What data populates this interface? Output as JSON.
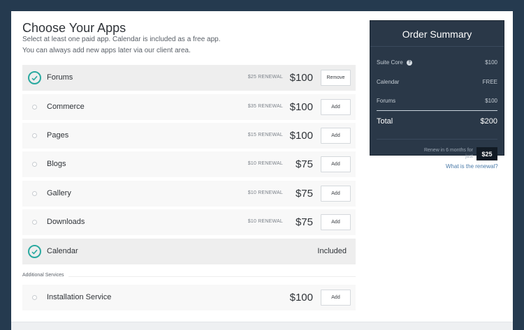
{
  "header": {
    "title": "Choose Your Apps",
    "subtitle_1": "Select at least one paid app. Calendar is included as a free app.",
    "subtitle_2": "You can always add new apps later via our client area."
  },
  "apps": [
    {
      "name": "Forums",
      "renewal": "$25 RENEWAL",
      "price": "$100",
      "button": "Remove",
      "selected": true
    },
    {
      "name": "Commerce",
      "renewal": "$35 RENEWAL",
      "price": "$100",
      "button": "Add",
      "selected": false
    },
    {
      "name": "Pages",
      "renewal": "$15 RENEWAL",
      "price": "$100",
      "button": "Add",
      "selected": false
    },
    {
      "name": "Blogs",
      "renewal": "$10 RENEWAL",
      "price": "$75",
      "button": "Add",
      "selected": false
    },
    {
      "name": "Gallery",
      "renewal": "$10 RENEWAL",
      "price": "$75",
      "button": "Add",
      "selected": false
    },
    {
      "name": "Downloads",
      "renewal": "$10 RENEWAL",
      "price": "$75",
      "button": "Add",
      "selected": false
    },
    {
      "name": "Calendar",
      "status": "Included",
      "selected": true
    }
  ],
  "additional": {
    "label": "Additional Services",
    "services": [
      {
        "name": "Installation Service",
        "price": "$100",
        "button": "Add"
      }
    ]
  },
  "summary": {
    "title": "Order Summary",
    "lines": [
      {
        "label": "Suite Core",
        "value": "$100",
        "help_icon": "question-circle-icon"
      },
      {
        "label": "Calendar",
        "value": "FREE"
      },
      {
        "label": "Forums",
        "value": "$100"
      }
    ],
    "total_label": "Total",
    "total_value": "$200",
    "renew_text": "Renew in 6 months for just",
    "renew_price": "$25",
    "renewal_link": "What is the renewal?"
  },
  "colors": {
    "page_background": "#253a4f",
    "accent_teal": "#2aa9a0",
    "summary_background": "#2a3848",
    "link": "#4a7aa8"
  }
}
